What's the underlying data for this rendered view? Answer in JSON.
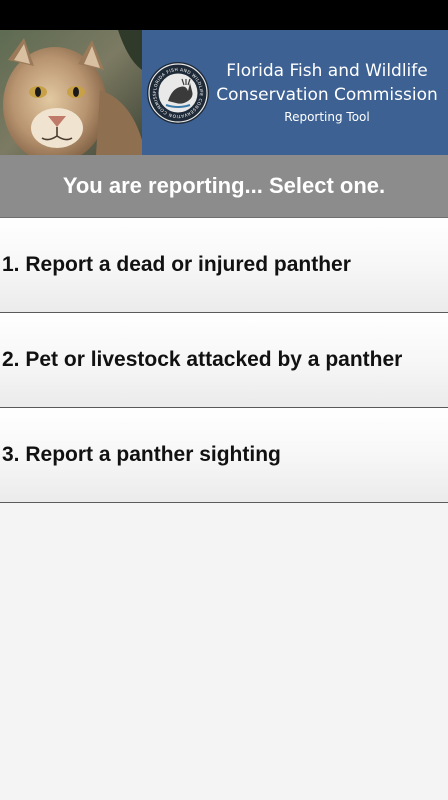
{
  "header": {
    "org_line1": "Florida Fish and Wildlife",
    "org_line2": "Conservation Commission",
    "subtitle": "Reporting Tool",
    "seal_text": "FLORIDA FISH AND WILDLIFE CONSERVATION COMMISSION"
  },
  "prompt": {
    "text": "You are reporting... Select one."
  },
  "options": [
    {
      "label": "1. Report a dead or injured panther"
    },
    {
      "label": "2. Pet or livestock attacked by a panther"
    },
    {
      "label": "3. Report a panther sighting"
    }
  ],
  "colors": {
    "status_bar": "#000000",
    "banner_blue": "#3d6193",
    "prompt_gray": "#8c8c8c",
    "background": "#f4f4f4"
  },
  "icons": {
    "photo": "panther-photo",
    "seal": "fwc-seal-icon"
  }
}
